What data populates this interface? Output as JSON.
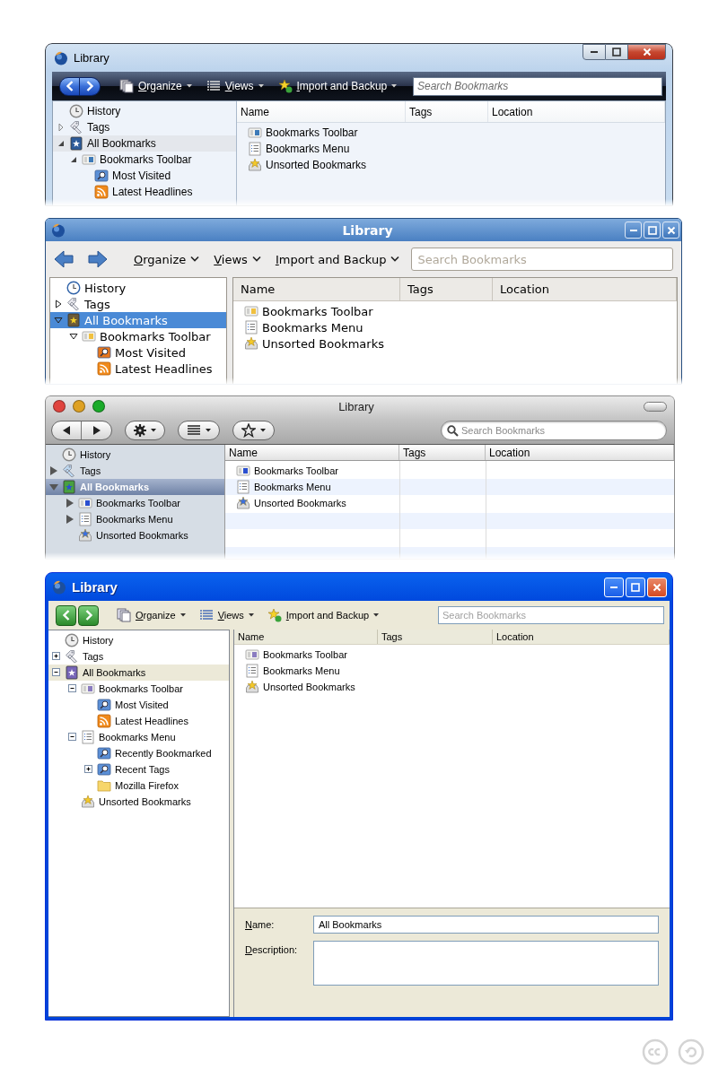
{
  "windows": [
    {
      "kind": "vista",
      "title": "Library",
      "menus": [
        {
          "kind": "organize",
          "label": "Organize"
        },
        {
          "kind": "views",
          "label": "Views"
        },
        {
          "kind": "import",
          "label": "Import and Backup"
        }
      ],
      "search": {
        "placeholder": "Search Bookmarks"
      },
      "sidebar": [
        {
          "label": "History",
          "kind": "history",
          "selected": false
        },
        {
          "label": "Tags",
          "kind": "tags",
          "expanded": false,
          "selected": false
        },
        {
          "label": "All Bookmarks",
          "kind": "all",
          "expanded": true,
          "selected": true,
          "children": [
            {
              "label": "Bookmarks Toolbar",
              "kind": "toolbar",
              "expanded": true,
              "selected": false,
              "children": [
                {
                  "label": "Most Visited",
                  "kind": "query",
                  "selected": false
                },
                {
                  "label": "Latest Headlines",
                  "kind": "feed",
                  "selected": false
                }
              ]
            }
          ]
        }
      ],
      "columns": [
        "Name",
        "Tags",
        "Location"
      ],
      "rows": [
        {
          "label": "Bookmarks Toolbar",
          "kind": "toolbar"
        },
        {
          "label": "Bookmarks Menu",
          "kind": "menu"
        },
        {
          "label": "Unsorted Bookmarks",
          "kind": "unsorted"
        }
      ]
    },
    {
      "kind": "gnome",
      "title": "Library",
      "menus": [
        {
          "kind": "organize",
          "label": "Organize"
        },
        {
          "kind": "views",
          "label": "Views"
        },
        {
          "kind": "import",
          "label": "Import and Backup"
        }
      ],
      "search": {
        "placeholder": "Search Bookmarks"
      },
      "sidebar": [
        {
          "label": "History",
          "kind": "history",
          "selected": false
        },
        {
          "label": "Tags",
          "kind": "tags",
          "expanded": false,
          "selected": false
        },
        {
          "label": "All Bookmarks",
          "kind": "all",
          "expanded": true,
          "selected": true,
          "children": [
            {
              "label": "Bookmarks Toolbar",
              "kind": "toolbar",
              "expanded": true,
              "selected": false,
              "children": [
                {
                  "label": "Most Visited",
                  "kind": "query",
                  "selected": false
                },
                {
                  "label": "Latest Headlines",
                  "kind": "feed",
                  "selected": false
                }
              ]
            }
          ]
        }
      ],
      "columns": [
        "Name",
        "Tags",
        "Location"
      ],
      "rows": [
        {
          "label": "Bookmarks Toolbar",
          "kind": "toolbar"
        },
        {
          "label": "Bookmarks Menu",
          "kind": "menu"
        },
        {
          "label": "Unsorted Bookmarks",
          "kind": "unsorted"
        }
      ]
    },
    {
      "kind": "mac",
      "title": "Library",
      "menus": [
        {
          "kind": "organize"
        },
        {
          "kind": "views"
        },
        {
          "kind": "import"
        }
      ],
      "search": {
        "placeholder": "Search Bookmarks"
      },
      "sidebar": [
        {
          "label": "History",
          "kind": "history",
          "selected": false
        },
        {
          "label": "Tags",
          "kind": "tags",
          "expanded": false,
          "selected": false
        },
        {
          "label": "All Bookmarks",
          "kind": "all",
          "expanded": true,
          "selected": true,
          "children": [
            {
              "label": "Bookmarks Toolbar",
              "kind": "toolbar",
              "expanded": false,
              "selected": false
            },
            {
              "label": "Bookmarks Menu",
              "kind": "menu",
              "expanded": false,
              "selected": false
            },
            {
              "label": "Unsorted Bookmarks",
              "kind": "unsorted",
              "selected": false
            }
          ]
        }
      ],
      "columns": [
        "Name",
        "Tags",
        "Location"
      ],
      "rows": [
        {
          "label": "Bookmarks Toolbar",
          "kind": "toolbar"
        },
        {
          "label": "Bookmarks Menu",
          "kind": "menu"
        },
        {
          "label": "Unsorted Bookmarks",
          "kind": "unsorted"
        }
      ]
    },
    {
      "kind": "xp",
      "title": "Library",
      "menus": [
        {
          "kind": "organize",
          "label": "Organize"
        },
        {
          "kind": "views",
          "label": "Views"
        },
        {
          "kind": "import",
          "label": "Import and Backup"
        }
      ],
      "search": {
        "placeholder": "Search Bookmarks"
      },
      "sidebar": [
        {
          "label": "History",
          "kind": "history",
          "selected": false
        },
        {
          "label": "Tags",
          "kind": "tags",
          "expanded": false,
          "selected": false
        },
        {
          "label": "All Bookmarks",
          "kind": "all",
          "expanded": true,
          "selected": true,
          "children": [
            {
              "label": "Bookmarks Toolbar",
              "kind": "toolbar",
              "expanded": true,
              "selected": false,
              "children": [
                {
                  "label": "Most Visited",
                  "kind": "query",
                  "selected": false
                },
                {
                  "label": "Latest Headlines",
                  "kind": "feed",
                  "selected": false
                }
              ]
            },
            {
              "label": "Bookmarks Menu",
              "kind": "menu",
              "expanded": true,
              "selected": false,
              "children": [
                {
                  "label": "Recently Bookmarked",
                  "kind": "query",
                  "selected": false
                },
                {
                  "label": "Recent Tags",
                  "kind": "query",
                  "expanded": false,
                  "selected": false
                },
                {
                  "label": "Mozilla Firefox",
                  "kind": "folder",
                  "selected": false
                }
              ]
            },
            {
              "label": "Unsorted Bookmarks",
              "kind": "unsorted",
              "selected": false
            }
          ]
        }
      ],
      "columns": [
        "Name",
        "Tags",
        "Location"
      ],
      "rows": [
        {
          "label": "Bookmarks Toolbar",
          "kind": "toolbar"
        },
        {
          "label": "Bookmarks Menu",
          "kind": "menu"
        },
        {
          "label": "Unsorted Bookmarks",
          "kind": "unsorted"
        }
      ],
      "details": {
        "name_label": "Name:",
        "name_value": "All Bookmarks",
        "description_label": "Description:"
      }
    }
  ]
}
